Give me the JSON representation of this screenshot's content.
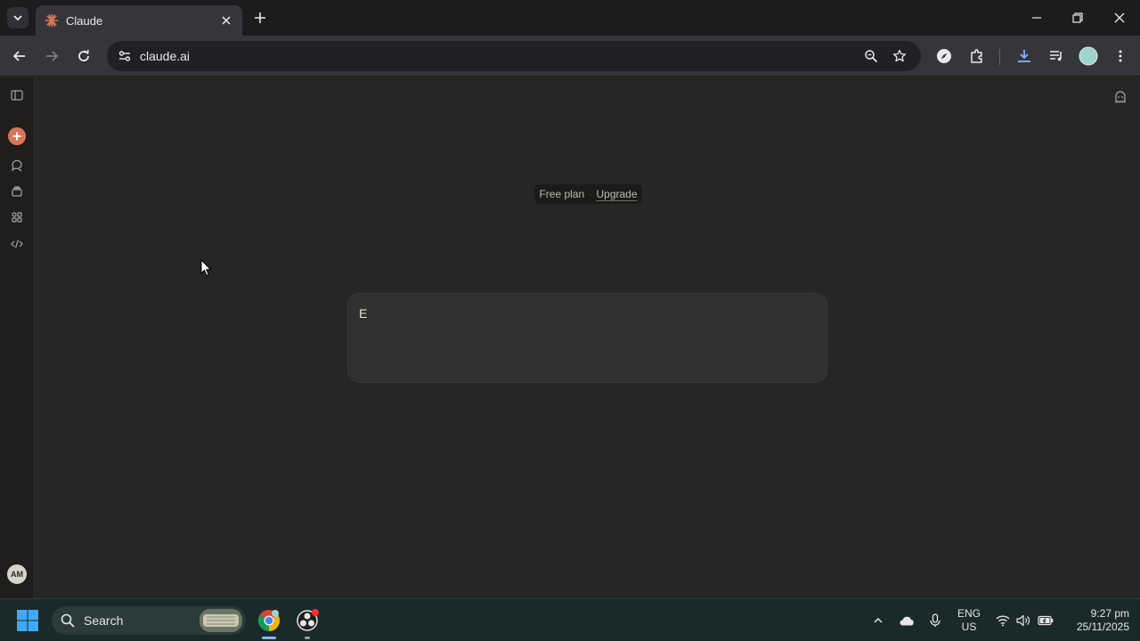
{
  "browser": {
    "tab": {
      "title": "Claude"
    },
    "address": {
      "url": "claude.ai"
    }
  },
  "app": {
    "plan": {
      "label": "Free plan",
      "separator": "·",
      "upgrade_label": "Upgrade"
    },
    "composer": {
      "value": "E"
    },
    "user": {
      "initials": "AM"
    }
  },
  "taskbar": {
    "search_placeholder": "Search",
    "language": {
      "line1": "ENG",
      "line2": "US"
    },
    "clock": {
      "time": "9:27 pm",
      "date": "25/11/2025"
    }
  },
  "colors": {
    "accent": "#d97757",
    "background": "#262624",
    "sidebar": "#1f1e1d",
    "composer": "#30302e"
  }
}
